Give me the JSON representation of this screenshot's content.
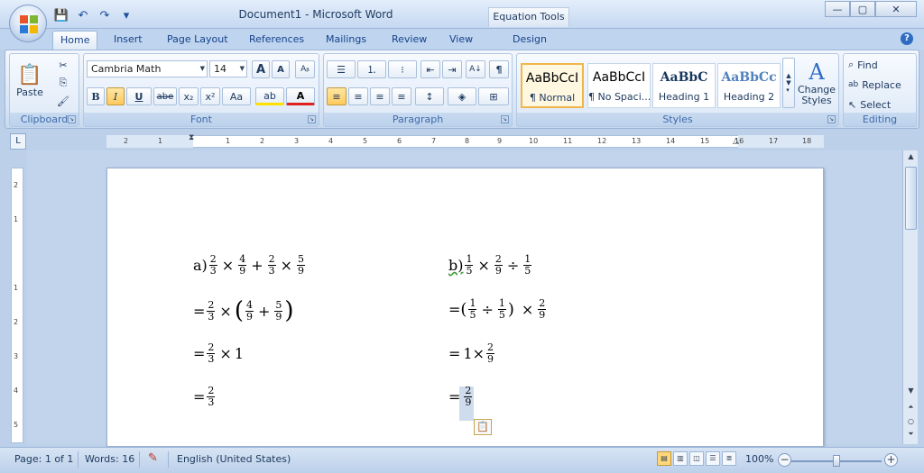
{
  "window": {
    "title": "Document1 - Microsoft Word",
    "contextual_tab": "Equation Tools",
    "controls": {
      "minimize": "—",
      "maximize": "▢",
      "close": "✕"
    }
  },
  "qat": {
    "save": "💾",
    "undo": "↶",
    "redo": "↷",
    "customize": "▾"
  },
  "tabs": {
    "home": "Home",
    "insert": "Insert",
    "page_layout": "Page Layout",
    "references": "References",
    "mailings": "Mailings",
    "review": "Review",
    "view": "View",
    "design": "Design"
  },
  "help": "?",
  "ribbon": {
    "clipboard": {
      "label": "Clipboard",
      "paste": "Paste",
      "paste_icon": "📋",
      "cut_icon": "✂",
      "copy_icon": "⎘",
      "painter_icon": "🖌"
    },
    "font": {
      "label": "Font",
      "family": "Cambria Math",
      "size": "14",
      "grow": "A",
      "shrink": "A",
      "clear": "Aᵦ",
      "bold": "B",
      "italic": "I",
      "underline": "U",
      "strike": "abe",
      "subscript": "x₂",
      "superscript": "x²",
      "case": "Aa",
      "highlight": "ab",
      "color": "A"
    },
    "paragraph": {
      "label": "Paragraph",
      "bullets": "☰",
      "numbering": "⒈",
      "multilevel": "⁝",
      "decrease_indent": "⇤",
      "increase_indent": "⇥",
      "sort": "A↓",
      "show_marks": "¶",
      "align_left": "≡",
      "center": "≡",
      "align_right": "≡",
      "justify": "≡",
      "line_spacing": "↕",
      "shading": "◈",
      "borders": "⊞"
    },
    "styles": {
      "label": "Styles",
      "items": [
        {
          "preview": "AaBbCcI",
          "name": "¶ Normal"
        },
        {
          "preview": "AaBbCcI",
          "name": "¶ No Spaci..."
        },
        {
          "preview": "AaBbC",
          "name": "Heading 1"
        },
        {
          "preview": "AaBbCc",
          "name": "Heading 2"
        }
      ],
      "change_styles": "Change Styles",
      "change_icon": "A"
    },
    "editing": {
      "label": "Editing",
      "find": "Find",
      "replace": "Replace",
      "select": "Select"
    }
  },
  "ruler": {
    "corner": "L",
    "ticks": [
      "2",
      "1",
      "1",
      "2",
      "3",
      "4",
      "5",
      "6",
      "7",
      "8",
      "9",
      "10",
      "11",
      "12",
      "13",
      "14",
      "15",
      "16",
      "17",
      "18"
    ],
    "vticks": [
      "2",
      "1",
      "1",
      "2",
      "3",
      "4",
      "5"
    ]
  },
  "document": {
    "a": {
      "label": "a)",
      "line1": {
        "f1n": "2",
        "f1d": "3",
        "op1": "×",
        "f2n": "4",
        "f2d": "9",
        "op2": "+",
        "f3n": "2",
        "f3d": "3",
        "op3": "×",
        "f4n": "5",
        "f4d": "9"
      },
      "line2": {
        "eq": "=",
        "f1n": "2",
        "f1d": "3",
        "op1": "×",
        "lp": "(",
        "f2n": "4",
        "f2d": "9",
        "op2": "+",
        "f3n": "5",
        "f3d": "9",
        "rp": ")"
      },
      "line3": {
        "eq": "=",
        "f1n": "2",
        "f1d": "3",
        "op1": "×",
        "val": "1"
      },
      "line4": {
        "eq": "=",
        "f1n": "2",
        "f1d": "3"
      }
    },
    "b": {
      "label": "b)",
      "line1": {
        "f1n": "1",
        "f1d": "5",
        "op1": "×",
        "f2n": "2",
        "f2d": "9",
        "op2": "÷",
        "f3n": "1",
        "f3d": "5"
      },
      "line2": {
        "eq": "=",
        "lp": "(",
        "f1n": "1",
        "f1d": "5",
        "op1": "÷",
        "f2n": "1",
        "f2d": "5",
        "rp": ")",
        "op2": "×",
        "f3n": "2",
        "f3d": "9"
      },
      "line3": {
        "eq": "=",
        "val": "1×",
        "f1n": "2",
        "f1d": "9"
      },
      "line4": {
        "eq": "=",
        "f1n": "2",
        "f1d": "9"
      }
    },
    "paste_options_icon": "📋"
  },
  "status": {
    "page": "Page: 1 of 1",
    "words": "Words: 16",
    "proof_icon": "✎",
    "language": "English (United States)",
    "zoom": "100%",
    "zoom_out": "−",
    "zoom_in": "+"
  }
}
